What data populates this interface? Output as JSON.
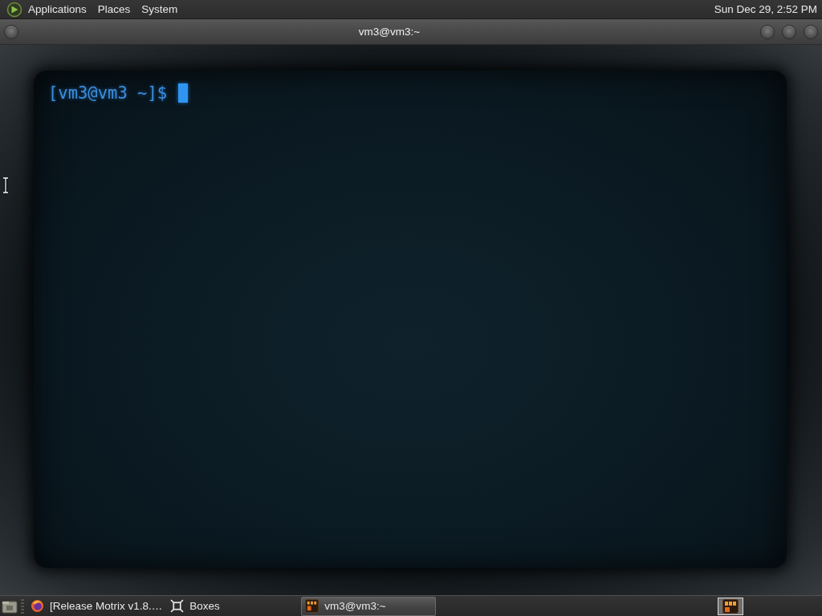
{
  "top_panel": {
    "menus": [
      {
        "label": "Applications"
      },
      {
        "label": "Places"
      },
      {
        "label": "System"
      }
    ],
    "clock": "Sun Dec 29, 2:52 PM"
  },
  "window": {
    "title": "vm3@vm3:~"
  },
  "terminal": {
    "prompt": "[vm3@vm3 ~]$"
  },
  "taskbar": {
    "tasks": [
      {
        "label": "[Release Motrix v1.8.…",
        "kind": "browser",
        "selected": false
      },
      {
        "label": "Boxes",
        "kind": "boxes",
        "selected": false
      },
      {
        "label": "vm3@vm3:~",
        "kind": "terminal",
        "selected": true
      }
    ]
  }
}
